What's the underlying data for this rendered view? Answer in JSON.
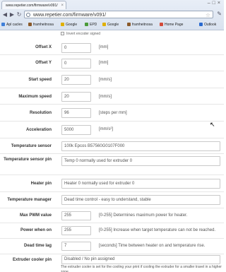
{
  "browser": {
    "tab_title": "www.repetier.com/firmware/v091/",
    "url": "www.repetier.com/firmware/v091/",
    "bookmarks": [
      {
        "label": "Apl cacles",
        "color": "#3f7fd8"
      },
      {
        "label": "framheitnosa",
        "color": "#8a5a2b"
      },
      {
        "label": "Google",
        "color": "#e0b000"
      },
      {
        "label": "EPD",
        "color": "#4a9a3a"
      },
      {
        "label": "Google",
        "color": "#e0b000"
      },
      {
        "label": "framheitnosa",
        "color": "#8a5a2b"
      },
      {
        "label": "Home Page",
        "color": "#d24a3a"
      },
      {
        "label": "Outlook",
        "color": "#2a6ad0"
      }
    ]
  },
  "form": {
    "signed_label": "Invert encoder signed",
    "rows": [
      {
        "label": "Offset X",
        "value": "0",
        "unit": "[mm]"
      },
      {
        "label": "Offset Y",
        "value": "0",
        "unit": "[mm]"
      },
      {
        "label": "Start speed",
        "value": "20",
        "unit": "[mm/s]"
      },
      {
        "label": "Maximum speed",
        "value": "20",
        "unit": "[mm/s]"
      },
      {
        "label": "Resolution",
        "value": "96",
        "unit": "[steps per mm]"
      },
      {
        "label": "Acceleration",
        "value": "5000",
        "unit": "[mm/s²]"
      },
      {
        "label": "Temperature sensor",
        "value": "100k Epcos B57560G0107F000",
        "unit": ""
      },
      {
        "label": "Temperature sensor pin",
        "value": "Temp 0 normally used for extruder 0",
        "unit": ""
      },
      {
        "label": "Heater pin",
        "value": "Heater 0 normally used for extruder 0",
        "unit": ""
      },
      {
        "label": "Temperature manager",
        "value": "Dead time control - easy to understand, stable",
        "unit": ""
      },
      {
        "label": "Max PWM value",
        "value": "255",
        "unit": "[0-255] Determines maximum power for heater."
      },
      {
        "label": "Power when on",
        "value": "255",
        "unit": "[0-255] Increase when target temperature can not be reached."
      },
      {
        "label": "Dead time lag",
        "value": "7",
        "unit": "[seconds] Time between heater on and temperature rise."
      },
      {
        "label": "Extruder cooler pin",
        "value": "Disabled / No pin assigned",
        "unit": ""
      }
    ],
    "footnote": "The extruder cooler is set for the cooling your print if cooling the extruder for a smaller travel in a higher zone."
  }
}
